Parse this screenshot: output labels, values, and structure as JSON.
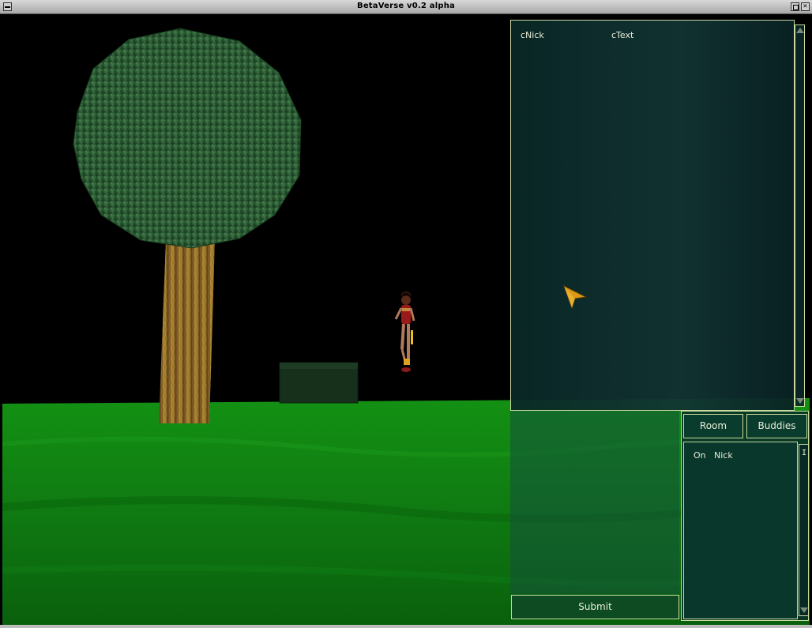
{
  "window": {
    "title": "BetaVerse v0.2 alpha"
  },
  "chat": {
    "columns": {
      "nick": "cNick",
      "text": "cText"
    },
    "messages": []
  },
  "input": {
    "submit_label": "Submit"
  },
  "users": {
    "tabs": {
      "room": "Room",
      "buddies": "Buddies"
    },
    "columns": {
      "on": "On",
      "nick": "Nick"
    },
    "scrollbar_glyph": "I"
  },
  "colors": {
    "panel_border": "#c9d9a0",
    "panel_text": "#e8ecd8",
    "grass": "#1c8a1c",
    "sky": "#000000"
  },
  "icons": {
    "cursor": "arrow-cursor-icon",
    "menu": "window-menu-icon",
    "maximize": "maximize-icon",
    "close": "close-icon"
  }
}
